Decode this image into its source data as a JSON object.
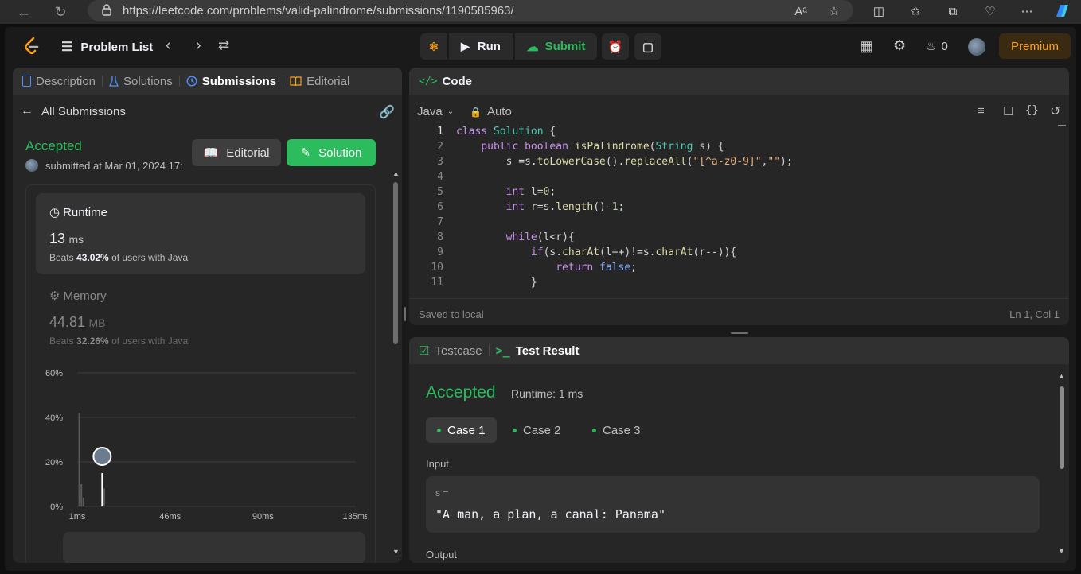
{
  "browser": {
    "url": "https://leetcode.com/problems/valid-palindrome/submissions/1190585963/"
  },
  "nav": {
    "problem_list": "Problem List",
    "run": "Run",
    "submit": "Submit",
    "streak": "0",
    "premium": "Premium"
  },
  "left": {
    "tabs": [
      "Description",
      "Solutions",
      "Submissions",
      "Editorial"
    ],
    "all_submissions": "All Submissions",
    "status": "Accepted",
    "submitted": "submitted at Mar 01, 2024 17:",
    "editorial_btn": "Editorial",
    "solution_btn": "Solution",
    "runtime": {
      "label": "Runtime",
      "value": "13",
      "unit": "ms",
      "beats_prefix": "Beats",
      "beats": "43.02%",
      "beats_suffix": "of users with Java"
    },
    "memory": {
      "label": "Memory",
      "value": "44.81",
      "unit": "MB",
      "beats_prefix": "Beats",
      "beats": "32.26%",
      "beats_suffix": "of users with Java"
    }
  },
  "chart_data": {
    "type": "bar",
    "y_ticks": [
      "60%",
      "40%",
      "20%",
      "0%"
    ],
    "x_ticks": [
      "1ms",
      "46ms",
      "90ms",
      "135ms"
    ],
    "ylim": [
      0,
      60
    ],
    "xlim": [
      1,
      135
    ],
    "bars": [
      {
        "x": 2,
        "y": 42
      },
      {
        "x": 3,
        "y": 10
      },
      {
        "x": 4,
        "y": 4
      },
      {
        "x": 13,
        "y": 15
      },
      {
        "x": 14,
        "y": 8
      }
    ],
    "marker_x": 13,
    "colors": {
      "bar": "#5a5a5a",
      "highlight": "#ffffff",
      "grid": "#3e3e3e"
    }
  },
  "code_panel": {
    "title": "Code",
    "language": "Java",
    "auto": "Auto",
    "saved": "Saved to local",
    "cursor": "Ln 1, Col 1",
    "line_numbers": [
      "1",
      "2",
      "3",
      "4",
      "5",
      "6",
      "7",
      "8",
      "9",
      "10",
      "11"
    ]
  },
  "result": {
    "testcase_tab": "Testcase",
    "result_tab": "Test Result",
    "status": "Accepted",
    "runtime": "Runtime: 1 ms",
    "cases": [
      "Case 1",
      "Case 2",
      "Case 3"
    ],
    "input_label": "Input",
    "var_name": "s =",
    "var_value": "\"A man, a plan, a canal: Panama\"",
    "output_label": "Output"
  }
}
